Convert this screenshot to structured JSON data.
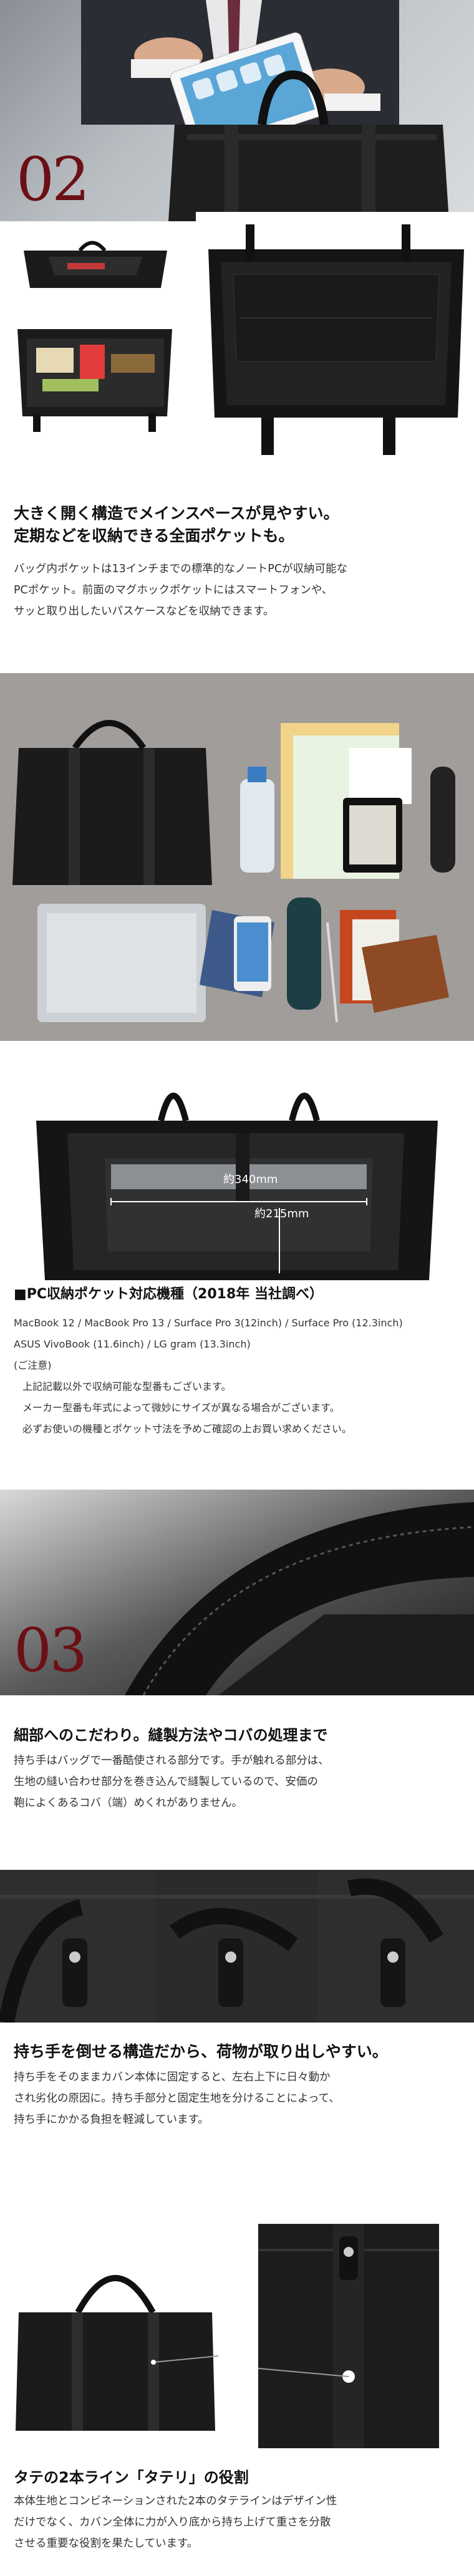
{
  "section02": {
    "number": "02",
    "heading_lines": [
      "大きく開く構造でメインスペースが見やすい。",
      "定期などを収納できる全面ポケットも。"
    ],
    "body_lines": [
      "バッグ内ポケットは13インチまでの標準的なノートPCが収納可能な",
      "PCポケット。前面のマグホックポケットにはスマートフォンや、",
      "サッと取り出したいパスケースなどを収納できます。"
    ]
  },
  "pc_pocket": {
    "dim_width": "約340mm",
    "dim_height": "約215mm",
    "title": "■PC収納ポケット対応機種（2018年 当社調べ）",
    "models_lines": [
      "MacBook 12 / MacBook Pro 13 / Surface Pro 3(12inch) / Surface Pro (12.3inch)",
      "ASUS VivoBook (11.6inch) / LG gram (13.3inch)"
    ],
    "note_title": "(ご注意)",
    "note_lines": [
      "上記記載以外で収納可能な型番もございます。",
      "メーカー型番も年式によって微妙にサイズが異なる場合がございます。",
      "必ずお使いの機種とポケット寸法を予めご確認の上お買い求めください。"
    ]
  },
  "section03": {
    "number": "03",
    "heading": "細部へのこだわり。縫製方法やコバの処理まで",
    "body_lines": [
      "持ち手はバッグで一番酷使される部分です。手が触れる部分は、",
      "生地の縫い合わせ部分を巻き込んで縫製しているので、安価の",
      "鞄によくあるコバ（端）めくれがありません。"
    ]
  },
  "handle": {
    "heading": "持ち手を倒せる構造だから、荷物が取り出しやすい。",
    "body_lines": [
      "持ち手をそのままカバン本体に固定すると、左右上下に日々動か",
      "され劣化の原因に。持ち手部分と固定生地を分けることによって、",
      "持ち手にかかる負担を軽減しています。"
    ]
  },
  "tateri": {
    "heading": "タテの2本ライン「タテリ」の役割",
    "body_lines": [
      "本体生地とコンビネーションされた2本のタテラインはデザイン性",
      "だけでなく、カバン全体に力が入り底から持ち上げて重さを分散",
      "させる重要な役割を果たしています。"
    ]
  },
  "colors": {
    "number_red": "#6b1015",
    "text_dark": "#222222",
    "bag_black": "#1e1e1e"
  }
}
